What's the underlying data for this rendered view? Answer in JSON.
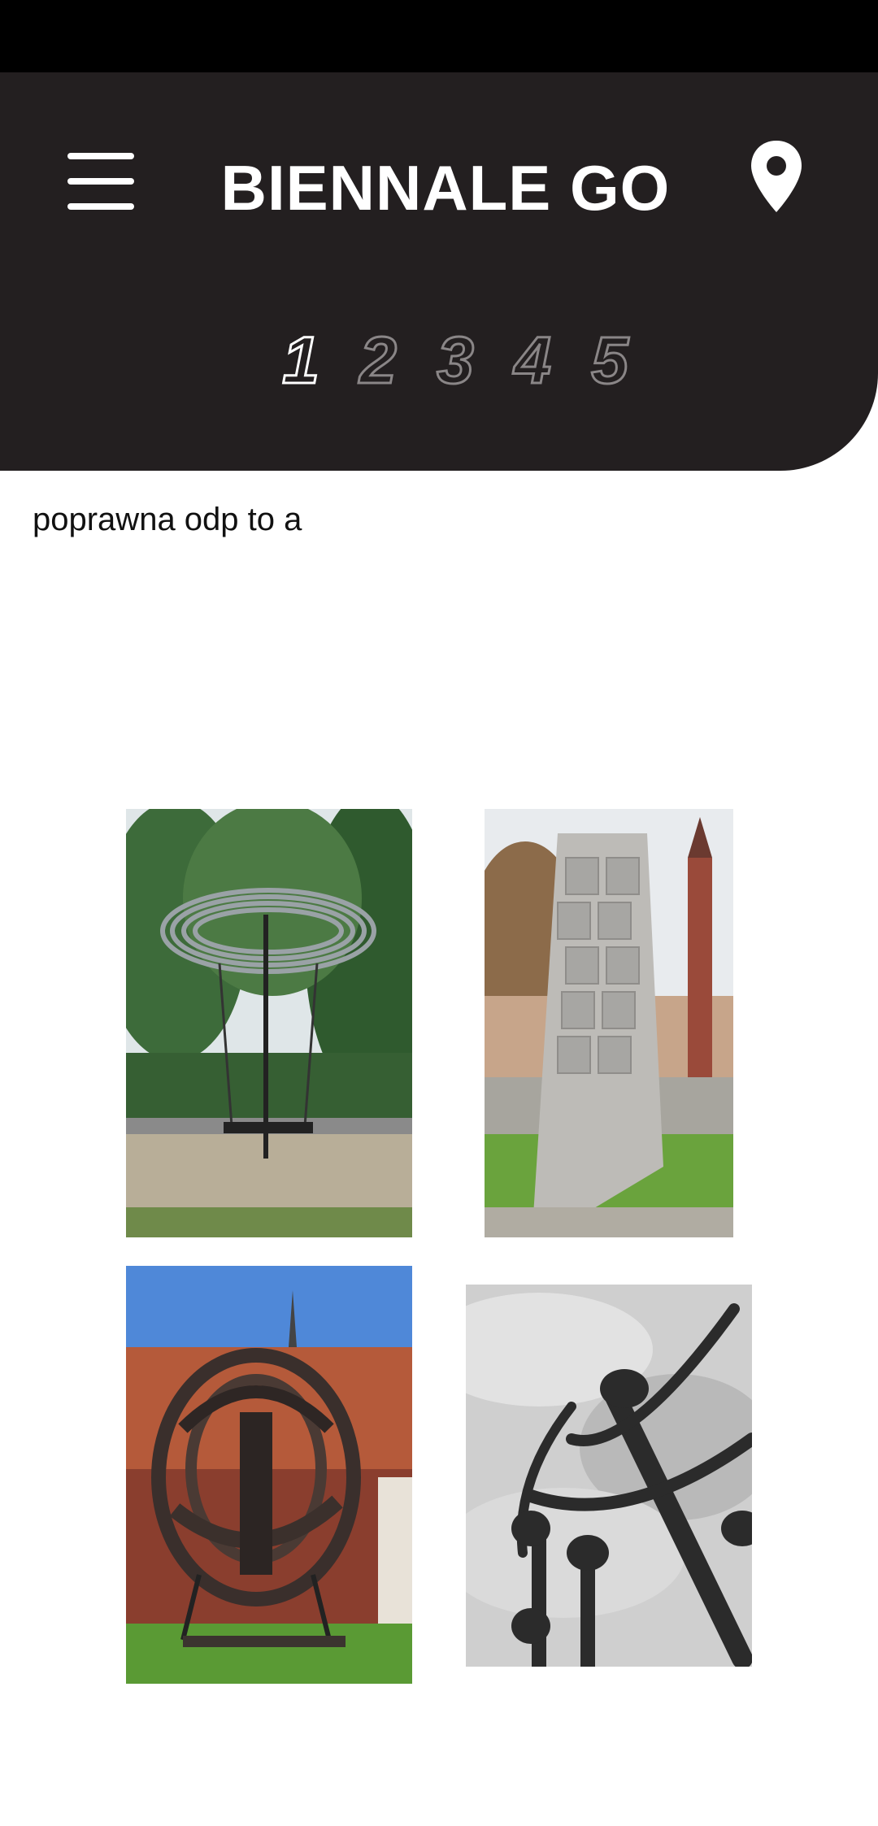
{
  "header": {
    "title": "BIENNALE GO",
    "menu_icon": "hamburger-menu-icon",
    "map_icon": "map-pin-icon"
  },
  "steps": {
    "items": [
      "1",
      "2",
      "3",
      "4",
      "5"
    ],
    "active": "1"
  },
  "question": {
    "text": "poprawna odp to a"
  },
  "answers": [
    {
      "id": "a",
      "image": "ring-sculpture-photo"
    },
    {
      "id": "b",
      "image": "panel-tower-sculpture-photo"
    },
    {
      "id": "c",
      "image": "rusted-head-sculpture-photo"
    },
    {
      "id": "d",
      "image": "black-arcs-sculpture-photo"
    }
  ],
  "colors": {
    "header_bg": "#231f20",
    "status_bar": "#000000",
    "active_step": "#ffffff",
    "inactive_step": "#8a8687"
  }
}
